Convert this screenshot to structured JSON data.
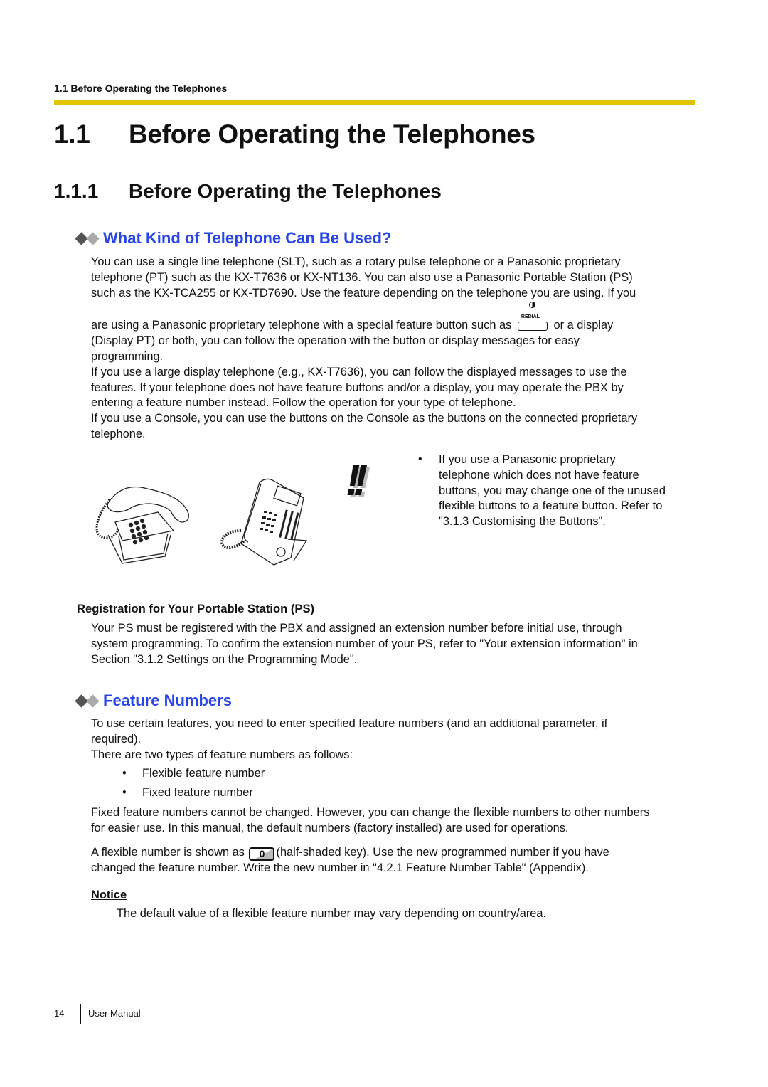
{
  "running_header": "1.1 Before Operating the Telephones",
  "heading1": {
    "number": "1.1",
    "title": "Before Operating the Telephones"
  },
  "heading2": {
    "number": "1.1.1",
    "title": "Before Operating the Telephones"
  },
  "section_what_kind": {
    "title": "What Kind of Telephone Can Be Used?",
    "para1_lines": [
      "You can use a single line telephone (SLT), such as a rotary pulse telephone or a Panasonic proprietary",
      "telephone (PT) such as the KX-T7636 or KX-NT136. You can also use a Panasonic Portable Station (PS)",
      "such as the KX-TCA255 or KX-TD7690. Use the feature depending on the telephone you are using. If you"
    ],
    "para1_line4_before": "are using a Panasonic proprietary telephone with a special feature button such as",
    "redial_button_label": "REDIAL",
    "para1_line4_after": "or a display",
    "para1_rest_lines": [
      "(Display PT) or both, you can follow the operation with the button or display messages for easy",
      "programming."
    ],
    "para2_lines": [
      "If you use a large display telephone (e.g., KX-T7636), you can follow the displayed messages to use the",
      "features. If your telephone does not have feature buttons and/or a display, you may operate the PBX by",
      "entering a feature number instead. Follow the operation for your type of telephone."
    ],
    "para3_lines": [
      "If you use a Console, you can use the buttons on the Console as the buttons on the connected proprietary",
      "telephone."
    ],
    "note": {
      "icon": "double-exclamation-icon",
      "bullet": "•",
      "lines": [
        "If you use a Panasonic proprietary",
        "telephone which does not have feature",
        "buttons, you may change one of the unused",
        "flexible buttons to a feature button. Refer to",
        "\"3.1.3 Customising the Buttons\"."
      ]
    },
    "images": [
      "single-line-telephone",
      "proprietary-telephone"
    ]
  },
  "registration": {
    "title": "Registration for Your Portable Station (PS)",
    "lines": [
      "Your PS must be registered with the PBX and assigned an extension number before initial use, through",
      "system programming. To confirm the extension number of your PS, refer to \"Your extension information\" in",
      "Section \"3.1.2 Settings on the Programming Mode\"."
    ]
  },
  "section_feature_numbers": {
    "title": "Feature Numbers",
    "para1_lines": [
      "To use certain features, you need to enter specified feature numbers (and an additional parameter, if",
      "required)."
    ],
    "para2": "There are two types of feature numbers as follows:",
    "bullets": [
      "Flexible feature number",
      "Fixed feature number"
    ],
    "bullet_char": "•",
    "para3_lines": [
      "Fixed feature numbers cannot be changed. However, you can change the flexible numbers to other numbers",
      "for easier use. In this manual, the default numbers (factory installed) are used for operations."
    ],
    "para4_before": "A flexible number is shown as",
    "key_label": "0",
    "para4_after": "(half-shaded key). Use the new programmed number if you have",
    "para4_line2": "changed the feature number. Write the new number in \"4.2.1 Feature Number Table\" (Appendix)."
  },
  "notice": {
    "label": "Notice",
    "text": "The default value of a flexible feature number may vary depending on country/area."
  },
  "footer": {
    "page_number": "14",
    "title": "User Manual"
  },
  "colors": {
    "accent_rule": "#e1c400",
    "section_blue": "#2846e8"
  }
}
